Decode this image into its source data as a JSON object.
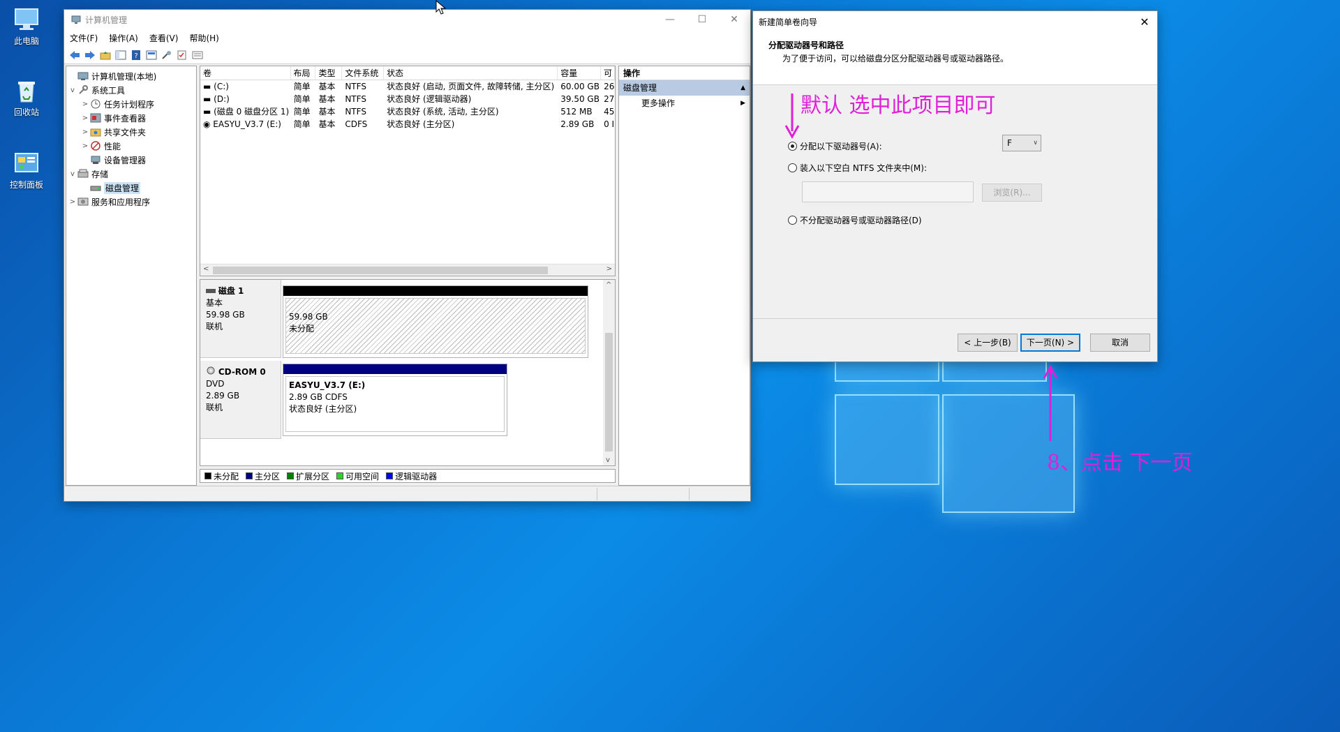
{
  "desktop": {
    "icons": [
      {
        "label": "此电脑",
        "icon": "computer-icon"
      },
      {
        "label": "回收站",
        "icon": "recycle-bin-icon"
      },
      {
        "label": "控制面板",
        "icon": "control-panel-icon"
      }
    ]
  },
  "cm_window": {
    "title": "计算机管理",
    "menu": [
      "文件(F)",
      "操作(A)",
      "查看(V)",
      "帮助(H)"
    ],
    "tree": [
      {
        "label": "计算机管理(本地)",
        "level": 0,
        "icon": "computer-management-icon",
        "expander": ""
      },
      {
        "label": "系统工具",
        "level": 1,
        "icon": "tools-icon",
        "expander": "v"
      },
      {
        "label": "任务计划程序",
        "level": 2,
        "icon": "clock-icon",
        "expander": ">"
      },
      {
        "label": "事件查看器",
        "level": 2,
        "icon": "event-viewer-icon",
        "expander": ">"
      },
      {
        "label": "共享文件夹",
        "level": 2,
        "icon": "shared-folder-icon",
        "expander": ">"
      },
      {
        "label": "性能",
        "level": 2,
        "icon": "performance-icon",
        "expander": ">"
      },
      {
        "label": "设备管理器",
        "level": 2,
        "icon": "device-manager-icon",
        "expander": ""
      },
      {
        "label": "存储",
        "level": 1,
        "icon": "storage-icon",
        "expander": "v"
      },
      {
        "label": "磁盘管理",
        "level": 2,
        "icon": "disk-management-icon",
        "expander": "",
        "selected": true
      },
      {
        "label": "服务和应用程序",
        "level": 1,
        "icon": "services-icon",
        "expander": ">"
      }
    ],
    "volume_table": {
      "headers": [
        "卷",
        "布局",
        "类型",
        "文件系统",
        "状态",
        "容量",
        "可"
      ],
      "rows": [
        [
          "(C:)",
          "简单",
          "基本",
          "NTFS",
          "状态良好 (启动, 页面文件, 故障转储, 主分区)",
          "60.00 GB",
          "26"
        ],
        [
          "(D:)",
          "简单",
          "基本",
          "NTFS",
          "状态良好 (逻辑驱动器)",
          "39.50 GB",
          "27"
        ],
        [
          "(磁盘 0 磁盘分区 1)",
          "简单",
          "基本",
          "NTFS",
          "状态良好 (系统, 活动, 主分区)",
          "512 MB",
          "45"
        ],
        [
          "EASYU_V3.7 (E:)",
          "简单",
          "基本",
          "CDFS",
          "状态良好 (主分区)",
          "2.89 GB",
          "0 I"
        ]
      ]
    },
    "disks": [
      {
        "name": "磁盘 1",
        "type": "基本",
        "size": "59.98 GB",
        "status": "联机",
        "partition": {
          "size": "59.98 GB",
          "desc": "未分配",
          "bar_color": "#000000"
        }
      },
      {
        "name": "CD-ROM 0",
        "type": "DVD",
        "size": "2.89 GB",
        "status": "联机",
        "partition": {
          "label": "EASYU_V3.7  (E:)",
          "size": "2.89 GB CDFS",
          "desc": "状态良好 (主分区)",
          "bar_color": "#000080"
        }
      }
    ],
    "legend": [
      {
        "label": "未分配",
        "color": "#000000"
      },
      {
        "label": "主分区",
        "color": "#000080"
      },
      {
        "label": "扩展分区",
        "color": "#008000"
      },
      {
        "label": "可用空间",
        "color": "#33cc33"
      },
      {
        "label": "逻辑驱动器",
        "color": "#0000ff"
      }
    ],
    "actions": {
      "header": "操作",
      "section": "磁盘管理",
      "item": "更多操作"
    }
  },
  "wizard": {
    "title": "新建简单卷向导",
    "heading": "分配驱动器号和路径",
    "subheading": "为了便于访问，可以给磁盘分区分配驱动器号或驱动器路径。",
    "option_assign": "分配以下驱动器号(A):",
    "option_mount": "装入以下空白 NTFS 文件夹中(M):",
    "option_none": "不分配驱动器号或驱动器路径(D)",
    "drive_letter": "F",
    "browse_label": "浏览(R)...",
    "back_label": "< 上一步(B)",
    "next_label": "下一页(N) >",
    "cancel_label": "取消"
  },
  "annotations": {
    "note_default": "默认 选中此项目即可",
    "note_next": "8、点击 下一页",
    "color": "#e020d8"
  }
}
